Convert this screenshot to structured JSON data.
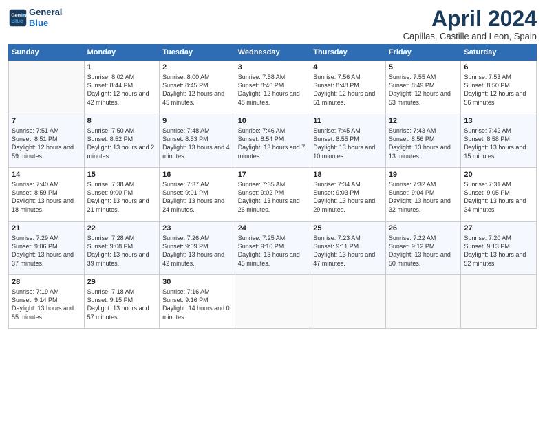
{
  "header": {
    "logo_line1": "General",
    "logo_line2": "Blue",
    "title": "April 2024",
    "subtitle": "Capillas, Castille and Leon, Spain"
  },
  "days_of_week": [
    "Sunday",
    "Monday",
    "Tuesday",
    "Wednesday",
    "Thursday",
    "Friday",
    "Saturday"
  ],
  "weeks": [
    [
      {
        "day": "",
        "sunrise": "",
        "sunset": "",
        "daylight": ""
      },
      {
        "day": "1",
        "sunrise": "Sunrise: 8:02 AM",
        "sunset": "Sunset: 8:44 PM",
        "daylight": "Daylight: 12 hours and 42 minutes."
      },
      {
        "day": "2",
        "sunrise": "Sunrise: 8:00 AM",
        "sunset": "Sunset: 8:45 PM",
        "daylight": "Daylight: 12 hours and 45 minutes."
      },
      {
        "day": "3",
        "sunrise": "Sunrise: 7:58 AM",
        "sunset": "Sunset: 8:46 PM",
        "daylight": "Daylight: 12 hours and 48 minutes."
      },
      {
        "day": "4",
        "sunrise": "Sunrise: 7:56 AM",
        "sunset": "Sunset: 8:48 PM",
        "daylight": "Daylight: 12 hours and 51 minutes."
      },
      {
        "day": "5",
        "sunrise": "Sunrise: 7:55 AM",
        "sunset": "Sunset: 8:49 PM",
        "daylight": "Daylight: 12 hours and 53 minutes."
      },
      {
        "day": "6",
        "sunrise": "Sunrise: 7:53 AM",
        "sunset": "Sunset: 8:50 PM",
        "daylight": "Daylight: 12 hours and 56 minutes."
      }
    ],
    [
      {
        "day": "7",
        "sunrise": "Sunrise: 7:51 AM",
        "sunset": "Sunset: 8:51 PM",
        "daylight": "Daylight: 12 hours and 59 minutes."
      },
      {
        "day": "8",
        "sunrise": "Sunrise: 7:50 AM",
        "sunset": "Sunset: 8:52 PM",
        "daylight": "Daylight: 13 hours and 2 minutes."
      },
      {
        "day": "9",
        "sunrise": "Sunrise: 7:48 AM",
        "sunset": "Sunset: 8:53 PM",
        "daylight": "Daylight: 13 hours and 4 minutes."
      },
      {
        "day": "10",
        "sunrise": "Sunrise: 7:46 AM",
        "sunset": "Sunset: 8:54 PM",
        "daylight": "Daylight: 13 hours and 7 minutes."
      },
      {
        "day": "11",
        "sunrise": "Sunrise: 7:45 AM",
        "sunset": "Sunset: 8:55 PM",
        "daylight": "Daylight: 13 hours and 10 minutes."
      },
      {
        "day": "12",
        "sunrise": "Sunrise: 7:43 AM",
        "sunset": "Sunset: 8:56 PM",
        "daylight": "Daylight: 13 hours and 13 minutes."
      },
      {
        "day": "13",
        "sunrise": "Sunrise: 7:42 AM",
        "sunset": "Sunset: 8:58 PM",
        "daylight": "Daylight: 13 hours and 15 minutes."
      }
    ],
    [
      {
        "day": "14",
        "sunrise": "Sunrise: 7:40 AM",
        "sunset": "Sunset: 8:59 PM",
        "daylight": "Daylight: 13 hours and 18 minutes."
      },
      {
        "day": "15",
        "sunrise": "Sunrise: 7:38 AM",
        "sunset": "Sunset: 9:00 PM",
        "daylight": "Daylight: 13 hours and 21 minutes."
      },
      {
        "day": "16",
        "sunrise": "Sunrise: 7:37 AM",
        "sunset": "Sunset: 9:01 PM",
        "daylight": "Daylight: 13 hours and 24 minutes."
      },
      {
        "day": "17",
        "sunrise": "Sunrise: 7:35 AM",
        "sunset": "Sunset: 9:02 PM",
        "daylight": "Daylight: 13 hours and 26 minutes."
      },
      {
        "day": "18",
        "sunrise": "Sunrise: 7:34 AM",
        "sunset": "Sunset: 9:03 PM",
        "daylight": "Daylight: 13 hours and 29 minutes."
      },
      {
        "day": "19",
        "sunrise": "Sunrise: 7:32 AM",
        "sunset": "Sunset: 9:04 PM",
        "daylight": "Daylight: 13 hours and 32 minutes."
      },
      {
        "day": "20",
        "sunrise": "Sunrise: 7:31 AM",
        "sunset": "Sunset: 9:05 PM",
        "daylight": "Daylight: 13 hours and 34 minutes."
      }
    ],
    [
      {
        "day": "21",
        "sunrise": "Sunrise: 7:29 AM",
        "sunset": "Sunset: 9:06 PM",
        "daylight": "Daylight: 13 hours and 37 minutes."
      },
      {
        "day": "22",
        "sunrise": "Sunrise: 7:28 AM",
        "sunset": "Sunset: 9:08 PM",
        "daylight": "Daylight: 13 hours and 39 minutes."
      },
      {
        "day": "23",
        "sunrise": "Sunrise: 7:26 AM",
        "sunset": "Sunset: 9:09 PM",
        "daylight": "Daylight: 13 hours and 42 minutes."
      },
      {
        "day": "24",
        "sunrise": "Sunrise: 7:25 AM",
        "sunset": "Sunset: 9:10 PM",
        "daylight": "Daylight: 13 hours and 45 minutes."
      },
      {
        "day": "25",
        "sunrise": "Sunrise: 7:23 AM",
        "sunset": "Sunset: 9:11 PM",
        "daylight": "Daylight: 13 hours and 47 minutes."
      },
      {
        "day": "26",
        "sunrise": "Sunrise: 7:22 AM",
        "sunset": "Sunset: 9:12 PM",
        "daylight": "Daylight: 13 hours and 50 minutes."
      },
      {
        "day": "27",
        "sunrise": "Sunrise: 7:20 AM",
        "sunset": "Sunset: 9:13 PM",
        "daylight": "Daylight: 13 hours and 52 minutes."
      }
    ],
    [
      {
        "day": "28",
        "sunrise": "Sunrise: 7:19 AM",
        "sunset": "Sunset: 9:14 PM",
        "daylight": "Daylight: 13 hours and 55 minutes."
      },
      {
        "day": "29",
        "sunrise": "Sunrise: 7:18 AM",
        "sunset": "Sunset: 9:15 PM",
        "daylight": "Daylight: 13 hours and 57 minutes."
      },
      {
        "day": "30",
        "sunrise": "Sunrise: 7:16 AM",
        "sunset": "Sunset: 9:16 PM",
        "daylight": "Daylight: 14 hours and 0 minutes."
      },
      {
        "day": "",
        "sunrise": "",
        "sunset": "",
        "daylight": ""
      },
      {
        "day": "",
        "sunrise": "",
        "sunset": "",
        "daylight": ""
      },
      {
        "day": "",
        "sunrise": "",
        "sunset": "",
        "daylight": ""
      },
      {
        "day": "",
        "sunrise": "",
        "sunset": "",
        "daylight": ""
      }
    ]
  ]
}
